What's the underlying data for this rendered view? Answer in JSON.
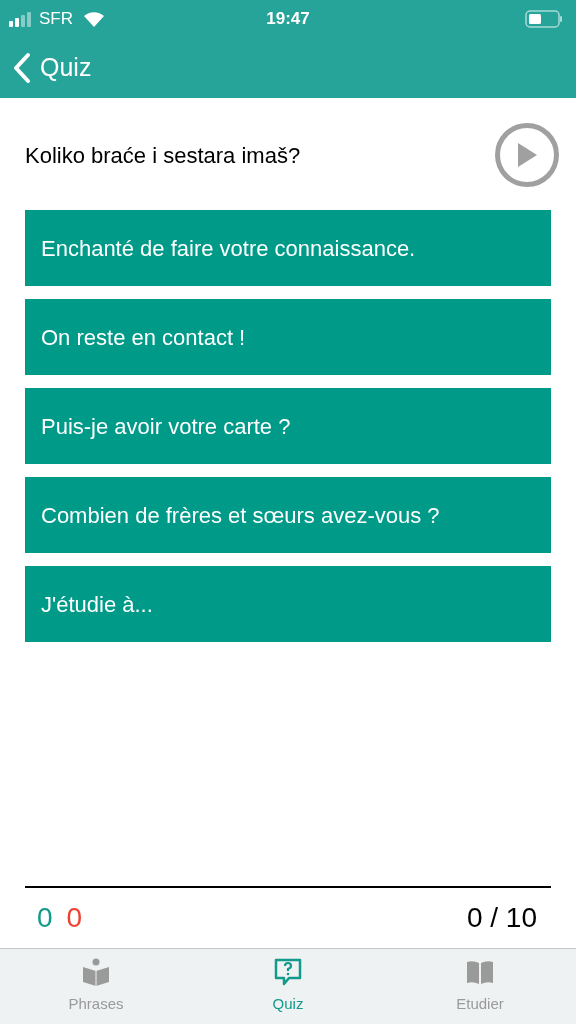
{
  "status_bar": {
    "carrier": "SFR",
    "time": "19:47"
  },
  "nav": {
    "back_label": "Quiz"
  },
  "question": {
    "text": "Koliko braće i sestara imaš?"
  },
  "answers": [
    {
      "text": "Enchanté de faire votre connaissance."
    },
    {
      "text": "On reste en contact !"
    },
    {
      "text": "Puis-je avoir votre carte ?"
    },
    {
      "text": "Combien de frères et sœurs avez-vous ?"
    },
    {
      "text": "J'étudie à..."
    }
  ],
  "score": {
    "correct": "0",
    "wrong": "0",
    "progress": "0 / 10"
  },
  "tabs": [
    {
      "kind": "phrases",
      "label": "Phrases",
      "selected": false
    },
    {
      "kind": "quiz",
      "label": "Quiz",
      "selected": true
    },
    {
      "kind": "study",
      "label": "Etudier",
      "selected": false
    }
  ]
}
